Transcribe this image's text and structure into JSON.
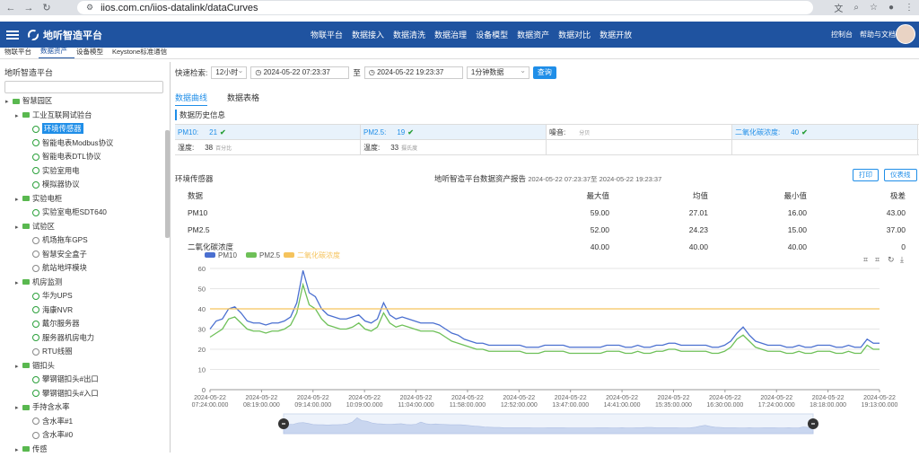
{
  "browser": {
    "url": "iios.com.cn/iios-datalink/dataCurves"
  },
  "app": {
    "brand": "地听智造平台",
    "nav": [
      "物联平台",
      "数据接入",
      "数据清洗",
      "数据治理",
      "设备模型",
      "数据资产",
      "数据对比",
      "数据开放"
    ],
    "right": [
      "控制台",
      "帮助与文档"
    ]
  },
  "subnav": {
    "items": [
      "物联平台",
      "数据资产",
      "设备模型",
      "Keystone标准通信"
    ],
    "active_index": 1
  },
  "sidebar": {
    "title": "地听智造平台",
    "tree": [
      {
        "label": "智慧园区",
        "level": 0,
        "type": "folder"
      },
      {
        "label": "工业互联网试验台",
        "level": 1,
        "type": "folder"
      },
      {
        "label": "环境传感器",
        "level": 2,
        "type": "leaf",
        "selected": true
      },
      {
        "label": "智能电表Modbus协议",
        "level": 2,
        "type": "leaf"
      },
      {
        "label": "智能电表DTL协议",
        "level": 2,
        "type": "leaf"
      },
      {
        "label": "实验室用电",
        "level": 2,
        "type": "leaf"
      },
      {
        "label": "模拟器协议",
        "level": 2,
        "type": "leaf"
      },
      {
        "label": "实验电柜",
        "level": 1,
        "type": "folder"
      },
      {
        "label": "实验室电柜SDT640",
        "level": 2,
        "type": "leaf"
      },
      {
        "label": "试验区",
        "level": 1,
        "type": "folder"
      },
      {
        "label": "机场拖车GPS",
        "level": 2,
        "type": "leaf-gray"
      },
      {
        "label": "智慧安全盒子",
        "level": 2,
        "type": "leaf-gray"
      },
      {
        "label": "航站地坪模块",
        "level": 2,
        "type": "leaf-gray"
      },
      {
        "label": "机房监测",
        "level": 1,
        "type": "folder"
      },
      {
        "label": "华为UPS",
        "level": 2,
        "type": "leaf"
      },
      {
        "label": "海康NVR",
        "level": 2,
        "type": "leaf"
      },
      {
        "label": "戴尔服务器",
        "level": 2,
        "type": "leaf"
      },
      {
        "label": "服务器机房电力",
        "level": 2,
        "type": "leaf"
      },
      {
        "label": "RTU线圈",
        "level": 2,
        "type": "leaf-gray"
      },
      {
        "label": "锢扣头",
        "level": 1,
        "type": "folder"
      },
      {
        "label": "攀钢锢扣头#出口",
        "level": 2,
        "type": "leaf"
      },
      {
        "label": "攀钢锢扣头#入口",
        "level": 2,
        "type": "leaf"
      },
      {
        "label": "手持含水率",
        "level": 1,
        "type": "folder"
      },
      {
        "label": "含水率#1",
        "level": 2,
        "type": "leaf-gray"
      },
      {
        "label": "含水率#0",
        "level": 2,
        "type": "leaf-gray"
      },
      {
        "label": "传感",
        "level": 1,
        "type": "folder"
      }
    ]
  },
  "query": {
    "label": "快速检索:",
    "range": "12小时",
    "start": "2024-05-22 07:23:37",
    "sep": "至",
    "end": "2024-05-22 19:23:37",
    "interval": "1分钟数据",
    "button": "查询"
  },
  "tabs": [
    "数据曲线",
    "数据表格"
  ],
  "history": {
    "title": "数据历史信息",
    "cells": [
      {
        "label": "PM10:",
        "value": "21",
        "unit": "",
        "ok": true,
        "hl": true
      },
      {
        "label": "PM2.5:",
        "value": "19",
        "unit": "",
        "ok": true,
        "hl": true
      },
      {
        "label": "噪音:",
        "value": "",
        "unit": "分贝",
        "ok": false,
        "hl": false
      },
      {
        "label": "二氧化碳浓度:",
        "value": "40",
        "unit": "",
        "ok": true,
        "hl": true
      },
      {
        "label": "湿度:",
        "value": "38",
        "unit": "百分比",
        "ok": false,
        "hl": false
      },
      {
        "label": "温度:",
        "value": "33",
        "unit": "摄氏度",
        "ok": false,
        "hl": false
      },
      {
        "label": "",
        "value": "",
        "unit": "",
        "ok": false,
        "hl": false
      },
      {
        "label": "",
        "value": "",
        "unit": "",
        "ok": false,
        "hl": false
      }
    ]
  },
  "report": {
    "section": "环境传感器",
    "title": "地听智造平台数据资产报告",
    "range": "2024-05-22 07:23:37至 2024-05-22 19:23:37",
    "print": "打印",
    "dashboard": "仪表线",
    "headers": [
      "数据",
      "最大值",
      "均值",
      "最小值",
      "极差"
    ],
    "rows": [
      [
        "PM10",
        "59.00",
        "27.01",
        "16.00",
        "43.00"
      ],
      [
        "PM2.5",
        "52.00",
        "24.23",
        "15.00",
        "37.00"
      ],
      [
        "二氧化碳浓度",
        "40.00",
        "40.00",
        "40.00",
        "0"
      ]
    ]
  },
  "chart_data": {
    "type": "line",
    "yticks": [
      0,
      10,
      20,
      30,
      40,
      50,
      60
    ],
    "ylim": [
      0,
      60
    ],
    "xticks": [
      [
        "2024-05-22",
        "07:24:00.000"
      ],
      [
        "2024-05-22",
        "08:19:00.000"
      ],
      [
        "2024-05-22",
        "09:14:00.000"
      ],
      [
        "2024-05-22",
        "10:09:00.000"
      ],
      [
        "2024-05-22",
        "11:04:00.000"
      ],
      [
        "2024-05-22",
        "11:58:00.000"
      ],
      [
        "2024-05-22",
        "12:52:00.000"
      ],
      [
        "2024-05-22",
        "13:47:00.000"
      ],
      [
        "2024-05-22",
        "14:41:00.000"
      ],
      [
        "2024-05-22",
        "15:35:00.000"
      ],
      [
        "2024-05-22",
        "16:30:00.000"
      ],
      [
        "2024-05-22",
        "17:24:00.000"
      ],
      [
        "2024-05-22",
        "18:18:00.000"
      ],
      [
        "2024-05-22",
        "19:13:00.000"
      ]
    ],
    "series": [
      {
        "name": "PM10",
        "color": "#4a6fd0",
        "values": [
          30,
          34,
          35,
          40,
          41,
          38,
          34,
          33,
          33,
          32,
          33,
          33,
          34,
          36,
          43,
          59,
          48,
          46,
          40,
          37,
          36,
          35,
          35,
          36,
          37,
          34,
          33,
          35,
          43,
          37,
          35,
          36,
          35,
          34,
          33,
          33,
          33,
          32,
          30,
          28,
          27,
          25,
          24,
          23,
          23,
          22,
          22,
          22,
          22,
          22,
          22,
          21,
          21,
          21,
          22,
          22,
          22,
          22,
          21,
          21,
          21,
          21,
          21,
          21,
          22,
          22,
          22,
          21,
          21,
          22,
          21,
          21,
          22,
          22,
          23,
          23,
          22,
          22,
          22,
          22,
          22,
          21,
          21,
          22,
          24,
          28,
          31,
          27,
          24,
          23,
          22,
          22,
          22,
          21,
          21,
          22,
          21,
          21,
          22,
          22,
          22,
          21,
          21,
          22,
          21,
          21,
          25,
          23,
          23
        ]
      },
      {
        "name": "PM2.5",
        "color": "#6ec058",
        "values": [
          26,
          28,
          30,
          35,
          36,
          33,
          30,
          29,
          29,
          28,
          29,
          29,
          30,
          32,
          38,
          52,
          42,
          40,
          35,
          32,
          31,
          30,
          30,
          31,
          33,
          30,
          29,
          31,
          38,
          33,
          31,
          32,
          31,
          30,
          29,
          29,
          29,
          28,
          26,
          24,
          23,
          22,
          21,
          20,
          20,
          19,
          19,
          19,
          19,
          19,
          19,
          18,
          18,
          18,
          19,
          19,
          19,
          19,
          18,
          18,
          18,
          18,
          18,
          18,
          19,
          19,
          19,
          18,
          18,
          19,
          18,
          18,
          19,
          19,
          20,
          20,
          19,
          19,
          19,
          19,
          19,
          18,
          18,
          19,
          21,
          25,
          27,
          24,
          21,
          20,
          19,
          19,
          19,
          18,
          18,
          19,
          18,
          18,
          19,
          19,
          19,
          18,
          18,
          19,
          18,
          18,
          22,
          20,
          20
        ]
      },
      {
        "name": "二氧化碳浓度",
        "color": "#f5c35c",
        "constant": 40
      }
    ]
  }
}
